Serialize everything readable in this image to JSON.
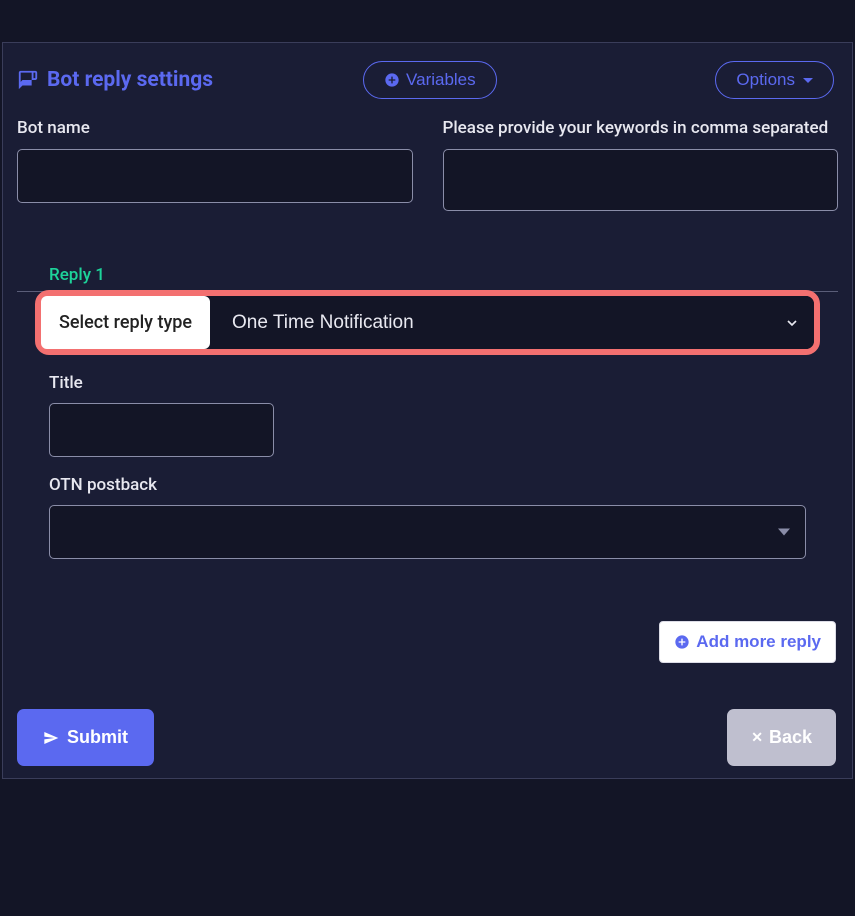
{
  "header": {
    "title": "Bot reply settings",
    "variables_label": "Variables",
    "options_label": "Options"
  },
  "fields": {
    "bot_name_label": "Bot name",
    "bot_name_value": "",
    "keywords_label": "Please provide your keywords in comma separated",
    "keywords_value": ""
  },
  "reply": {
    "section_label": "Reply 1",
    "type_label": "Select reply type",
    "type_value": "One Time Notification",
    "title_label": "Title",
    "title_value": "",
    "otn_label": "OTN postback",
    "otn_value": ""
  },
  "actions": {
    "add_more": "Add more reply",
    "submit": "Submit",
    "back": "Back"
  },
  "colors": {
    "accent": "#5b69f0",
    "success": "#1dd39a",
    "highlight": "#f37070",
    "bg": "#131526",
    "panel": "#1a1d35"
  }
}
